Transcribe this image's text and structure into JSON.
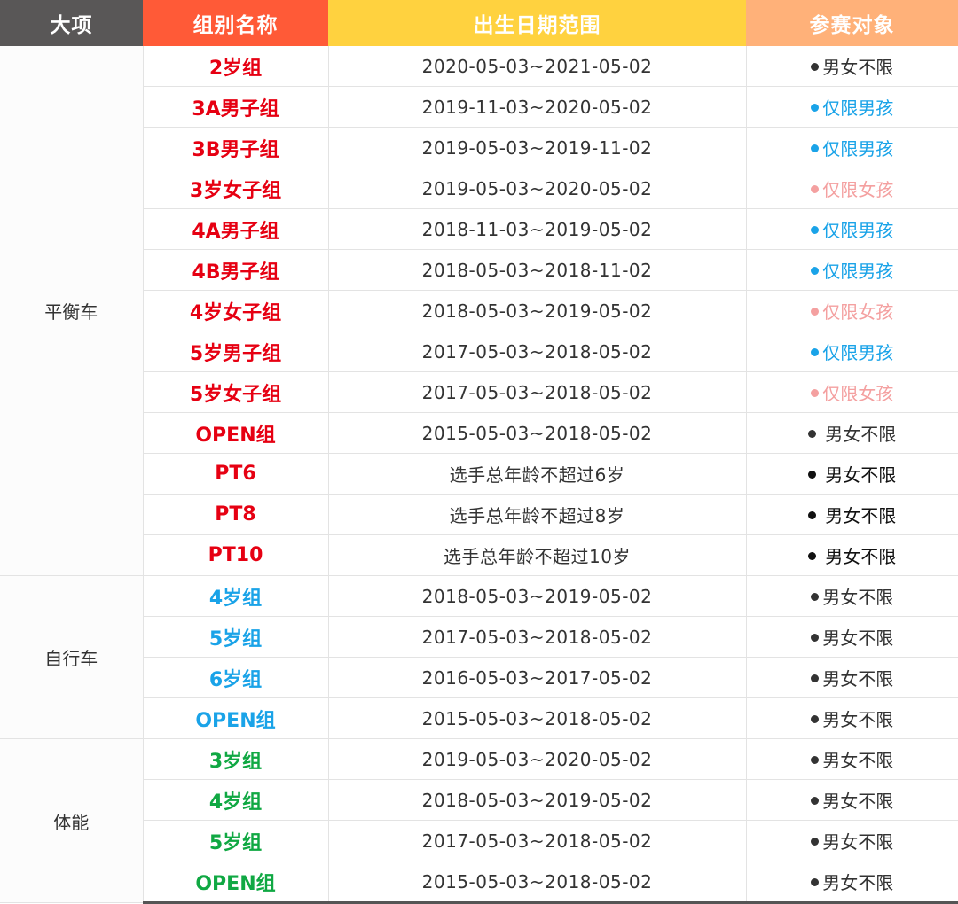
{
  "header": {
    "col1": "大项",
    "col2": "组别名称",
    "col3": "出生日期范围",
    "col4": "参赛对象"
  },
  "colors": {
    "header_dark": "#595757",
    "header_orange": "#ff5a37",
    "header_yellow": "#ffd23f",
    "header_peach": "#ffb179",
    "group_red": "#e60012",
    "group_blue": "#1aa3e8",
    "group_green": "#10a843",
    "target_any": "#333333",
    "target_boys": "#1aa3e8",
    "target_girls": "#f4a0a0"
  },
  "sections": [
    {
      "category": "平衡车",
      "color": "red",
      "rows": [
        {
          "group": "2岁组",
          "dates": "2020-05-03~2021-05-02",
          "target": "男女不限",
          "tcolor": "#333333",
          "gap": false
        },
        {
          "group": "3A男子组",
          "dates": "2019-11-03~2020-05-02",
          "target": "仅限男孩",
          "tcolor": "#1aa3e8",
          "gap": false
        },
        {
          "group": "3B男子组",
          "dates": "2019-05-03~2019-11-02",
          "target": "仅限男孩",
          "tcolor": "#1aa3e8",
          "gap": false
        },
        {
          "group": "3岁女子组",
          "dates": "2019-05-03~2020-05-02",
          "target": "仅限女孩",
          "tcolor": "#f4a0a0",
          "gap": false
        },
        {
          "group": "4A男子组",
          "dates": "2018-11-03~2019-05-02",
          "target": "仅限男孩",
          "tcolor": "#1aa3e8",
          "gap": false
        },
        {
          "group": "4B男子组",
          "dates": "2018-05-03~2018-11-02",
          "target": "仅限男孩",
          "tcolor": "#1aa3e8",
          "gap": false
        },
        {
          "group": "4岁女子组",
          "dates": "2018-05-03~2019-05-02",
          "target": "仅限女孩",
          "tcolor": "#f4a0a0",
          "gap": false
        },
        {
          "group": "5岁男子组",
          "dates": "2017-05-03~2018-05-02",
          "target": "仅限男孩",
          "tcolor": "#1aa3e8",
          "gap": false
        },
        {
          "group": "5岁女子组",
          "dates": "2017-05-03~2018-05-02",
          "target": "仅限女孩",
          "tcolor": "#f4a0a0",
          "gap": false
        },
        {
          "group": "OPEN组",
          "dates": "2015-05-03~2018-05-02",
          "target": "男女不限",
          "tcolor": "#333333",
          "gap": true
        },
        {
          "group": "PT6",
          "dates": "选手总年龄不超过6岁",
          "target": "男女不限",
          "tcolor": "#111111",
          "gap": true
        },
        {
          "group": "PT8",
          "dates": "选手总年龄不超过8岁",
          "target": "男女不限",
          "tcolor": "#111111",
          "gap": true
        },
        {
          "group": "PT10",
          "dates": "选手总年龄不超过10岁",
          "target": "男女不限",
          "tcolor": "#111111",
          "gap": true
        }
      ]
    },
    {
      "category": "自行车",
      "color": "blue",
      "rows": [
        {
          "group": "4岁组",
          "dates": "2018-05-03~2019-05-02",
          "target": "男女不限",
          "tcolor": "#333333",
          "gap": false
        },
        {
          "group": "5岁组",
          "dates": "2017-05-03~2018-05-02",
          "target": "男女不限",
          "tcolor": "#333333",
          "gap": false
        },
        {
          "group": "6岁组",
          "dates": "2016-05-03~2017-05-02",
          "target": "男女不限",
          "tcolor": "#333333",
          "gap": false
        },
        {
          "group": "OPEN组",
          "dates": "2015-05-03~2018-05-02",
          "target": "男女不限",
          "tcolor": "#333333",
          "gap": false
        }
      ]
    },
    {
      "category": "体能",
      "color": "green",
      "rows": [
        {
          "group": "3岁组",
          "dates": "2019-05-03~2020-05-02",
          "target": "男女不限",
          "tcolor": "#333333",
          "gap": false
        },
        {
          "group": "4岁组",
          "dates": "2018-05-03~2019-05-02",
          "target": "男女不限",
          "tcolor": "#333333",
          "gap": false
        },
        {
          "group": "5岁组",
          "dates": "2017-05-03~2018-05-02",
          "target": "男女不限",
          "tcolor": "#333333",
          "gap": false
        },
        {
          "group": "OPEN组",
          "dates": "2015-05-03~2018-05-02",
          "target": "男女不限",
          "tcolor": "#333333",
          "gap": false
        }
      ]
    }
  ]
}
